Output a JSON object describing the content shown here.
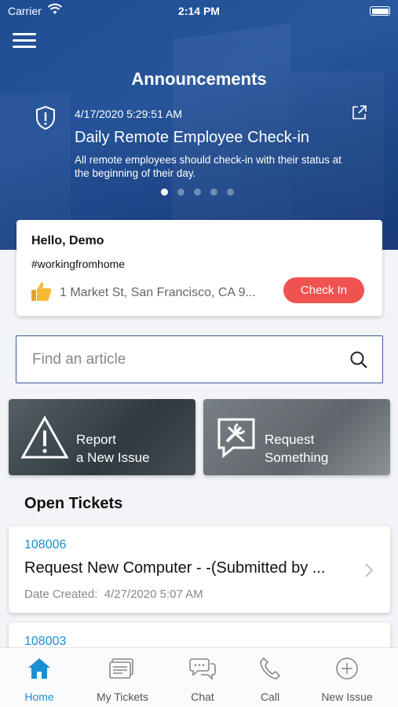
{
  "status_bar": {
    "carrier": "Carrier",
    "time": "2:14 PM"
  },
  "header": {
    "title": "Announcements"
  },
  "announcement": {
    "datetime": "4/17/2020 5:29:51 AM",
    "headline": "Daily Remote Employee Check-in",
    "body": "All remote employees should check-in with their status at the beginning of their day.",
    "page_count": 5,
    "active_page": 1
  },
  "checkin": {
    "greeting": "Hello, Demo",
    "hashtag": "#workingfromhome",
    "address": "1 Market St, San Francisco, CA 9...",
    "button_label": "Check In"
  },
  "search": {
    "placeholder": "Find an article"
  },
  "tiles": [
    {
      "label_line1": "Report",
      "label_line2": "a New Issue"
    },
    {
      "label_line1": "Request",
      "label_line2": "Something"
    }
  ],
  "open_tickets": {
    "heading": "Open Tickets",
    "items": [
      {
        "id": "108006",
        "subject": "Request New Computer - -(Submitted by ...",
        "date_label": "Date Created:",
        "date": "4/27/2020 5:07 AM"
      },
      {
        "id": "108003"
      }
    ]
  },
  "tabbar": {
    "tabs": [
      {
        "label": "Home",
        "icon": "home-icon",
        "active": true
      },
      {
        "label": "My Tickets",
        "icon": "tickets-icon",
        "active": false
      },
      {
        "label": "Chat",
        "icon": "chat-icon",
        "active": false
      },
      {
        "label": "Call",
        "icon": "phone-icon",
        "active": false
      },
      {
        "label": "New Issue",
        "icon": "plus-circle-icon",
        "active": false
      }
    ]
  },
  "colors": {
    "accent": "#1b8fd1",
    "checkin_button": "#f0524f",
    "hero": "#2d5fa6"
  }
}
